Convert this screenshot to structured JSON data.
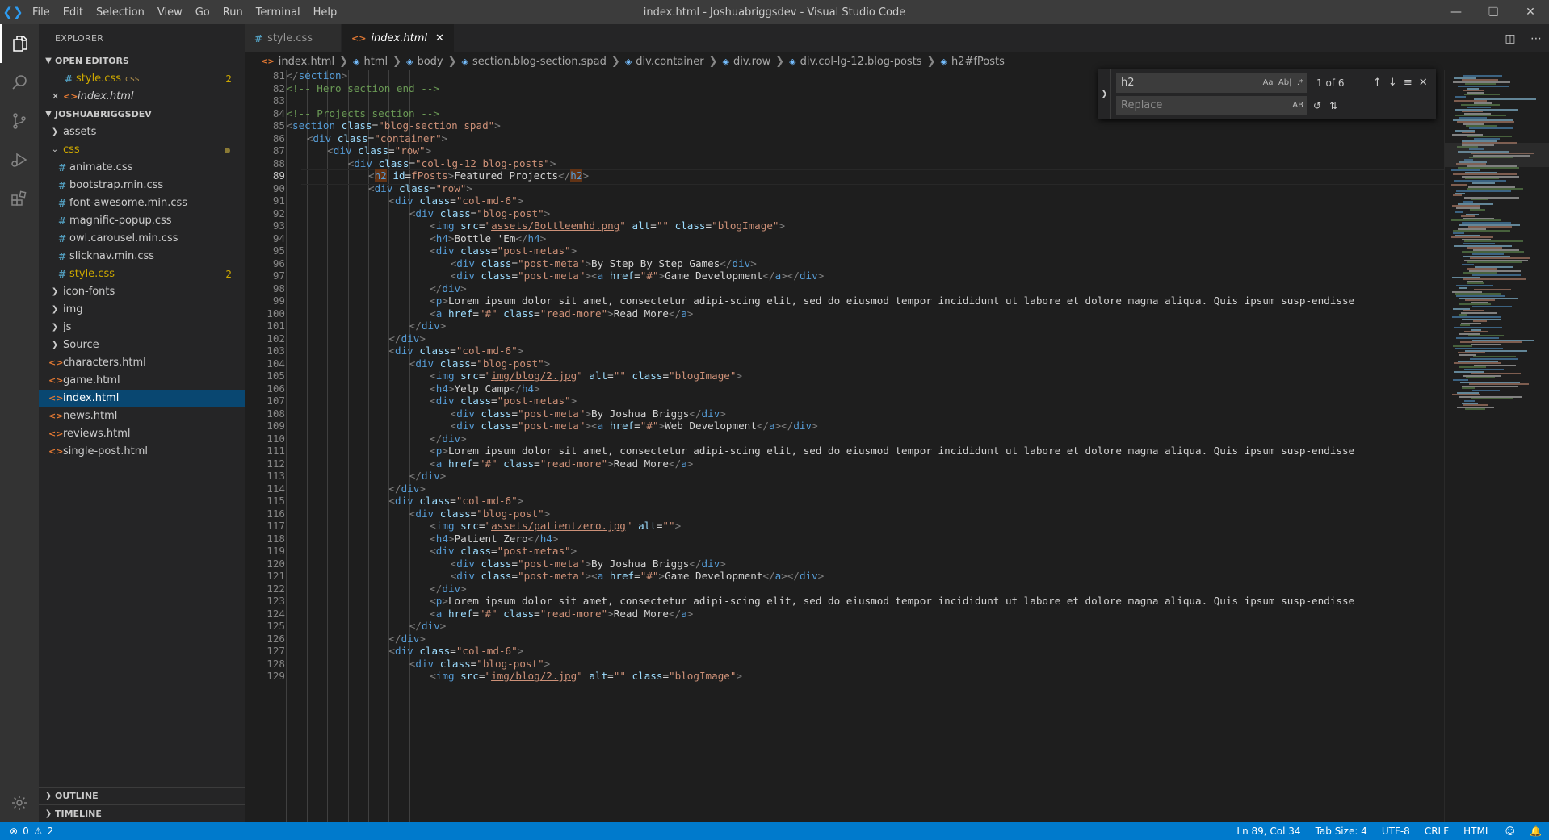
{
  "window": {
    "title": "index.html - Joshuabriggsdev - Visual Studio Code",
    "menu": [
      "File",
      "Edit",
      "Selection",
      "View",
      "Go",
      "Run",
      "Terminal",
      "Help"
    ]
  },
  "sidebar": {
    "header": "EXPLORER",
    "open_editors_label": "OPEN EDITORS",
    "open_editors": [
      {
        "name": "style.css",
        "hint": "css",
        "badge": "2",
        "type": "css"
      },
      {
        "name": "index.html",
        "type": "html"
      }
    ],
    "project_label": "JOSHUABRIGGSDEV",
    "tree": [
      {
        "name": "assets",
        "kind": "folder",
        "collapsed": true
      },
      {
        "name": "css",
        "kind": "folder",
        "collapsed": false,
        "modified": true
      },
      {
        "name": "animate.css",
        "kind": "css",
        "indent": 1
      },
      {
        "name": "bootstrap.min.css",
        "kind": "css",
        "indent": 1
      },
      {
        "name": "font-awesome.min.css",
        "kind": "css",
        "indent": 1
      },
      {
        "name": "magnific-popup.css",
        "kind": "css",
        "indent": 1
      },
      {
        "name": "owl.carousel.min.css",
        "kind": "css",
        "indent": 1
      },
      {
        "name": "slicknav.min.css",
        "kind": "css",
        "indent": 1
      },
      {
        "name": "style.css",
        "kind": "css",
        "indent": 1,
        "badge": "2"
      },
      {
        "name": "icon-fonts",
        "kind": "folder",
        "collapsed": true
      },
      {
        "name": "img",
        "kind": "folder",
        "collapsed": true
      },
      {
        "name": "js",
        "kind": "folder",
        "collapsed": true
      },
      {
        "name": "Source",
        "kind": "folder",
        "collapsed": true
      },
      {
        "name": "characters.html",
        "kind": "html"
      },
      {
        "name": "game.html",
        "kind": "html"
      },
      {
        "name": "index.html",
        "kind": "html",
        "selected": true
      },
      {
        "name": "news.html",
        "kind": "html"
      },
      {
        "name": "reviews.html",
        "kind": "html"
      },
      {
        "name": "single-post.html",
        "kind": "html"
      }
    ],
    "outline_label": "OUTLINE",
    "timeline_label": "TIMELINE"
  },
  "tabs": [
    {
      "label": "style.css",
      "type": "css",
      "active": false
    },
    {
      "label": "index.html",
      "type": "html",
      "active": true
    }
  ],
  "breadcrumb": [
    "index.html",
    "html",
    "body",
    "section.blog-section.spad",
    "div.container",
    "div.row",
    "div.col-lg-12.blog-posts",
    "h2#fPosts"
  ],
  "find": {
    "query": "h2",
    "result_count": "1 of 6",
    "replace_placeholder": "Replace",
    "opt_case": "Aa",
    "opt_word": "Ab|",
    "opt_regex": ".*",
    "opt_preserve": "AB"
  },
  "editor": {
    "current_line": 89,
    "lines": [
      {
        "n": 81,
        "html": "<span class=\"p\">&lt;/</span><span class=\"t\">section</span><span class=\"p\">&gt;</span>",
        "indent": 1
      },
      {
        "n": 82,
        "html": "<span class=\"c\">&lt;!-- Hero section end --&gt;</span>",
        "indent": 1
      },
      {
        "n": 83,
        "html": "",
        "indent": 0
      },
      {
        "n": 84,
        "html": "<span class=\"c\">&lt;!-- Projects section --&gt;</span>",
        "indent": 1
      },
      {
        "n": 85,
        "html": "<span class=\"p\">&lt;</span><span class=\"t\">section</span> <span class=\"a\">class</span>=<span class=\"s\">\"blog-section spad\"</span><span class=\"p\">&gt;</span>",
        "indent": 1
      },
      {
        "n": 86,
        "html": "<span class=\"p\">&lt;</span><span class=\"t\">div</span> <span class=\"a\">class</span>=<span class=\"s\">\"container\"</span><span class=\"p\">&gt;</span>",
        "indent": 2
      },
      {
        "n": 87,
        "html": "<span class=\"p\">&lt;</span><span class=\"t\">div</span> <span class=\"a\">class</span>=<span class=\"s\">\"row\"</span><span class=\"p\">&gt;</span>",
        "indent": 3
      },
      {
        "n": 88,
        "html": "<span class=\"p\">&lt;</span><span class=\"t\">div</span> <span class=\"a\">class</span>=<span class=\"s\">\"col-lg-12 blog-posts\"</span><span class=\"p\">&gt;</span>",
        "indent": 4
      },
      {
        "n": 89,
        "html": "<span class=\"p\">&lt;</span><span class=\"t hl\">h2</span> <span class=\"a\">id</span>=<span class=\"s\">fPosts</span><span class=\"p\">&gt;</span>Featured Projects<span class=\"p\">&lt;/</span><span class=\"t hl\">h2</span><span class=\"p\">&gt;</span>",
        "indent": 5
      },
      {
        "n": 90,
        "html": "<span class=\"p\">&lt;</span><span class=\"t\">div</span> <span class=\"a\">class</span>=<span class=\"s\">\"row\"</span><span class=\"p\">&gt;</span>",
        "indent": 5
      },
      {
        "n": 91,
        "html": "<span class=\"p\">&lt;</span><span class=\"t\">div</span> <span class=\"a\">class</span>=<span class=\"s\">\"col-md-6\"</span><span class=\"p\">&gt;</span>",
        "indent": 6
      },
      {
        "n": 92,
        "html": "<span class=\"p\">&lt;</span><span class=\"t\">div</span> <span class=\"a\">class</span>=<span class=\"s\">\"blog-post\"</span><span class=\"p\">&gt;</span>",
        "indent": 7
      },
      {
        "n": 93,
        "html": "<span class=\"p\">&lt;</span><span class=\"t\">img</span> <span class=\"a\">src</span>=<span class=\"s\">\"<span class=\"u\">assets/Bottleemhd.png</span>\"</span> <span class=\"a\">alt</span>=<span class=\"s\">\"\"</span> <span class=\"a\">class</span>=<span class=\"s\">\"blogImage\"</span><span class=\"p\">&gt;</span>",
        "indent": 8
      },
      {
        "n": 94,
        "html": "<span class=\"p\">&lt;</span><span class=\"t\">h4</span><span class=\"p\">&gt;</span>Bottle 'Em<span class=\"p\">&lt;/</span><span class=\"t\">h4</span><span class=\"p\">&gt;</span>",
        "indent": 8
      },
      {
        "n": 95,
        "html": "<span class=\"p\">&lt;</span><span class=\"t\">div</span> <span class=\"a\">class</span>=<span class=\"s\">\"post-metas\"</span><span class=\"p\">&gt;</span>",
        "indent": 8
      },
      {
        "n": 96,
        "html": "<span class=\"p\">&lt;</span><span class=\"t\">div</span> <span class=\"a\">class</span>=<span class=\"s\">\"post-meta\"</span><span class=\"p\">&gt;</span>By Step By Step Games<span class=\"p\">&lt;/</span><span class=\"t\">div</span><span class=\"p\">&gt;</span>",
        "indent": 9
      },
      {
        "n": 97,
        "html": "<span class=\"p\">&lt;</span><span class=\"t\">div</span> <span class=\"a\">class</span>=<span class=\"s\">\"post-meta\"</span><span class=\"p\">&gt;&lt;</span><span class=\"t\">a</span> <span class=\"a\">href</span>=<span class=\"s\">\"#\"</span><span class=\"p\">&gt;</span>Game Development<span class=\"p\">&lt;/</span><span class=\"t\">a</span><span class=\"p\">&gt;&lt;/</span><span class=\"t\">div</span><span class=\"p\">&gt;</span>",
        "indent": 9
      },
      {
        "n": 98,
        "html": "<span class=\"p\">&lt;/</span><span class=\"t\">div</span><span class=\"p\">&gt;</span>",
        "indent": 8
      },
      {
        "n": 99,
        "html": "<span class=\"p\">&lt;</span><span class=\"t\">p</span><span class=\"p\">&gt;</span>Lorem ipsum dolor sit amet, consectetur adipi-scing elit, sed do eiusmod tempor incididunt ut labore et dolore magna aliqua. Quis ipsum susp-endisse",
        "indent": 8
      },
      {
        "n": 100,
        "html": "<span class=\"p\">&lt;</span><span class=\"t\">a</span> <span class=\"a\">href</span>=<span class=\"s\">\"#\"</span> <span class=\"a\">class</span>=<span class=\"s\">\"read-more\"</span><span class=\"p\">&gt;</span>Read More<span class=\"p\">&lt;/</span><span class=\"t\">a</span><span class=\"p\">&gt;</span>",
        "indent": 8
      },
      {
        "n": 101,
        "html": "<span class=\"p\">&lt;/</span><span class=\"t\">div</span><span class=\"p\">&gt;</span>",
        "indent": 7
      },
      {
        "n": 102,
        "html": "<span class=\"p\">&lt;/</span><span class=\"t\">div</span><span class=\"p\">&gt;</span>",
        "indent": 6
      },
      {
        "n": 103,
        "html": "<span class=\"p\">&lt;</span><span class=\"t\">div</span> <span class=\"a\">class</span>=<span class=\"s\">\"col-md-6\"</span><span class=\"p\">&gt;</span>",
        "indent": 6
      },
      {
        "n": 104,
        "html": "<span class=\"p\">&lt;</span><span class=\"t\">div</span> <span class=\"a\">class</span>=<span class=\"s\">\"blog-post\"</span><span class=\"p\">&gt;</span>",
        "indent": 7
      },
      {
        "n": 105,
        "html": "<span class=\"p\">&lt;</span><span class=\"t\">img</span> <span class=\"a\">src</span>=<span class=\"s\">\"<span class=\"u\">img/blog/2.jpg</span>\"</span> <span class=\"a\">alt</span>=<span class=\"s\">\"\"</span> <span class=\"a\">class</span>=<span class=\"s\">\"blogImage\"</span><span class=\"p\">&gt;</span>",
        "indent": 8
      },
      {
        "n": 106,
        "html": "<span class=\"p\">&lt;</span><span class=\"t\">h4</span><span class=\"p\">&gt;</span>Yelp Camp<span class=\"p\">&lt;/</span><span class=\"t\">h4</span><span class=\"p\">&gt;</span>",
        "indent": 8
      },
      {
        "n": 107,
        "html": "<span class=\"p\">&lt;</span><span class=\"t\">div</span> <span class=\"a\">class</span>=<span class=\"s\">\"post-metas\"</span><span class=\"p\">&gt;</span>",
        "indent": 8
      },
      {
        "n": 108,
        "html": "<span class=\"p\">&lt;</span><span class=\"t\">div</span> <span class=\"a\">class</span>=<span class=\"s\">\"post-meta\"</span><span class=\"p\">&gt;</span>By Joshua Briggs<span class=\"p\">&lt;/</span><span class=\"t\">div</span><span class=\"p\">&gt;</span>",
        "indent": 9
      },
      {
        "n": 109,
        "html": "<span class=\"p\">&lt;</span><span class=\"t\">div</span> <span class=\"a\">class</span>=<span class=\"s\">\"post-meta\"</span><span class=\"p\">&gt;&lt;</span><span class=\"t\">a</span> <span class=\"a\">href</span>=<span class=\"s\">\"#\"</span><span class=\"p\">&gt;</span>Web Development<span class=\"p\">&lt;/</span><span class=\"t\">a</span><span class=\"p\">&gt;&lt;/</span><span class=\"t\">div</span><span class=\"p\">&gt;</span>",
        "indent": 9
      },
      {
        "n": 110,
        "html": "<span class=\"p\">&lt;/</span><span class=\"t\">div</span><span class=\"p\">&gt;</span>",
        "indent": 8
      },
      {
        "n": 111,
        "html": "<span class=\"p\">&lt;</span><span class=\"t\">p</span><span class=\"p\">&gt;</span>Lorem ipsum dolor sit amet, consectetur adipi-scing elit, sed do eiusmod tempor incididunt ut labore et dolore magna aliqua. Quis ipsum susp-endisse",
        "indent": 8
      },
      {
        "n": 112,
        "html": "<span class=\"p\">&lt;</span><span class=\"t\">a</span> <span class=\"a\">href</span>=<span class=\"s\">\"#\"</span> <span class=\"a\">class</span>=<span class=\"s\">\"read-more\"</span><span class=\"p\">&gt;</span>Read More<span class=\"p\">&lt;/</span><span class=\"t\">a</span><span class=\"p\">&gt;</span>",
        "indent": 8
      },
      {
        "n": 113,
        "html": "<span class=\"p\">&lt;/</span><span class=\"t\">div</span><span class=\"p\">&gt;</span>",
        "indent": 7
      },
      {
        "n": 114,
        "html": "<span class=\"p\">&lt;/</span><span class=\"t\">div</span><span class=\"p\">&gt;</span>",
        "indent": 6
      },
      {
        "n": 115,
        "html": "<span class=\"p\">&lt;</span><span class=\"t\">div</span> <span class=\"a\">class</span>=<span class=\"s\">\"col-md-6\"</span><span class=\"p\">&gt;</span>",
        "indent": 6
      },
      {
        "n": 116,
        "html": "<span class=\"p\">&lt;</span><span class=\"t\">div</span> <span class=\"a\">class</span>=<span class=\"s\">\"blog-post\"</span><span class=\"p\">&gt;</span>",
        "indent": 7
      },
      {
        "n": 117,
        "html": "<span class=\"p\">&lt;</span><span class=\"t\">img</span> <span class=\"a\">src</span>=<span class=\"s\">\"<span class=\"u\">assets/patientzero.jpg</span>\"</span> <span class=\"a\">alt</span>=<span class=\"s\">\"\"</span><span class=\"p\">&gt;</span>",
        "indent": 8
      },
      {
        "n": 118,
        "html": "<span class=\"p\">&lt;</span><span class=\"t\">h4</span><span class=\"p\">&gt;</span>Patient Zero<span class=\"p\">&lt;/</span><span class=\"t\">h4</span><span class=\"p\">&gt;</span>",
        "indent": 8
      },
      {
        "n": 119,
        "html": "<span class=\"p\">&lt;</span><span class=\"t\">div</span> <span class=\"a\">class</span>=<span class=\"s\">\"post-metas\"</span><span class=\"p\">&gt;</span>",
        "indent": 8
      },
      {
        "n": 120,
        "html": "<span class=\"p\">&lt;</span><span class=\"t\">div</span> <span class=\"a\">class</span>=<span class=\"s\">\"post-meta\"</span><span class=\"p\">&gt;</span>By Joshua Briggs<span class=\"p\">&lt;/</span><span class=\"t\">div</span><span class=\"p\">&gt;</span>",
        "indent": 9
      },
      {
        "n": 121,
        "html": "<span class=\"p\">&lt;</span><span class=\"t\">div</span> <span class=\"a\">class</span>=<span class=\"s\">\"post-meta\"</span><span class=\"p\">&gt;&lt;</span><span class=\"t\">a</span> <span class=\"a\">href</span>=<span class=\"s\">\"#\"</span><span class=\"p\">&gt;</span>Game Development<span class=\"p\">&lt;/</span><span class=\"t\">a</span><span class=\"p\">&gt;&lt;/</span><span class=\"t\">div</span><span class=\"p\">&gt;</span>",
        "indent": 9
      },
      {
        "n": 122,
        "html": "<span class=\"p\">&lt;/</span><span class=\"t\">div</span><span class=\"p\">&gt;</span>",
        "indent": 8
      },
      {
        "n": 123,
        "html": "<span class=\"p\">&lt;</span><span class=\"t\">p</span><span class=\"p\">&gt;</span>Lorem ipsum dolor sit amet, consectetur adipi-scing elit, sed do eiusmod tempor incididunt ut labore et dolore magna aliqua. Quis ipsum susp-endisse",
        "indent": 8
      },
      {
        "n": 124,
        "html": "<span class=\"p\">&lt;</span><span class=\"t\">a</span> <span class=\"a\">href</span>=<span class=\"s\">\"#\"</span> <span class=\"a\">class</span>=<span class=\"s\">\"read-more\"</span><span class=\"p\">&gt;</span>Read More<span class=\"p\">&lt;/</span><span class=\"t\">a</span><span class=\"p\">&gt;</span>",
        "indent": 8
      },
      {
        "n": 125,
        "html": "<span class=\"p\">&lt;/</span><span class=\"t\">div</span><span class=\"p\">&gt;</span>",
        "indent": 7
      },
      {
        "n": 126,
        "html": "<span class=\"p\">&lt;/</span><span class=\"t\">div</span><span class=\"p\">&gt;</span>",
        "indent": 6
      },
      {
        "n": 127,
        "html": "<span class=\"p\">&lt;</span><span class=\"t\">div</span> <span class=\"a\">class</span>=<span class=\"s\">\"col-md-6\"</span><span class=\"p\">&gt;</span>",
        "indent": 6
      },
      {
        "n": 128,
        "html": "<span class=\"p\">&lt;</span><span class=\"t\">div</span> <span class=\"a\">class</span>=<span class=\"s\">\"blog-post\"</span><span class=\"p\">&gt;</span>",
        "indent": 7
      },
      {
        "n": 129,
        "html": "<span class=\"p\">&lt;</span><span class=\"t\">img</span> <span class=\"a\">src</span>=<span class=\"s\">\"<span class=\"u\">img/blog/2.jpg</span>\"</span> <span class=\"a\">alt</span>=<span class=\"s\">\"\"</span> <span class=\"a\">class</span>=<span class=\"s\">\"blogImage\"</span><span class=\"p\">&gt;</span>",
        "indent": 8
      }
    ]
  },
  "status": {
    "errors": "0",
    "warnings": "2",
    "position": "Ln 89, Col 34",
    "tab_size": "Tab Size: 4",
    "encoding": "UTF-8",
    "eol": "CRLF",
    "language": "HTML"
  },
  "colors": {
    "accent": "#007acc",
    "selection": "#094771"
  }
}
